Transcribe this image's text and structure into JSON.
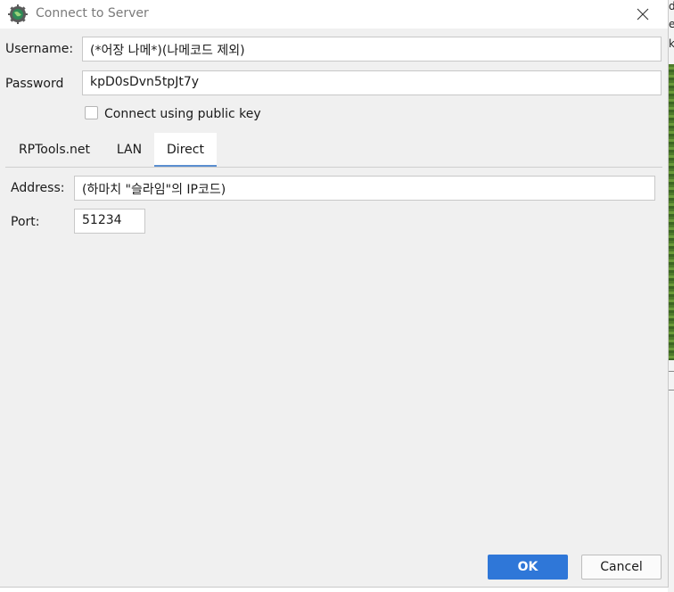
{
  "window": {
    "title": "Connect to Server",
    "app_icon": "gear-globe-icon",
    "close_icon": "close-icon"
  },
  "form": {
    "username_label": "Username:",
    "username_value": "(*어장 나메*)(나메코드 제외)",
    "password_label": "Password",
    "password_value": "kpD0sDvn5tpJt7y",
    "public_key_label": "Connect using public key",
    "public_key_checked": false
  },
  "tabs": [
    {
      "label": "RPTools.net",
      "active": false
    },
    {
      "label": "LAN",
      "active": false
    },
    {
      "label": "Direct",
      "active": true
    }
  ],
  "direct": {
    "address_label": "Address:",
    "address_value": "(하마치 \"슬라임\"의 IP코드)",
    "port_label": "Port:",
    "port_value": "51234"
  },
  "buttons": {
    "ok": "OK",
    "cancel": "Cancel"
  },
  "background": {
    "edge_letters": [
      "d",
      "e",
      "k"
    ]
  },
  "colors": {
    "accent": "#2f77d8",
    "tab_underline": "#5b8fd0"
  }
}
